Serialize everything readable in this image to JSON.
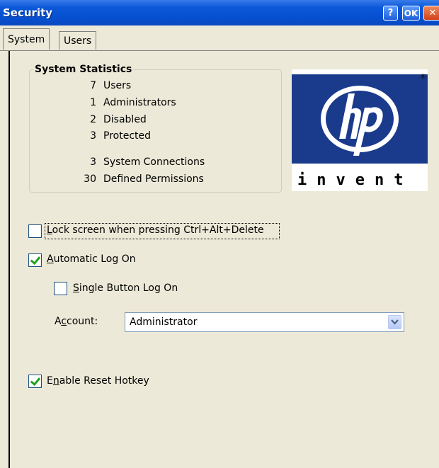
{
  "window": {
    "title": "Security",
    "help_label": "?",
    "ok_label": "OK",
    "close_label": "✕"
  },
  "tabs": [
    {
      "label": "System",
      "active": true
    },
    {
      "label": "Users",
      "active": false
    }
  ],
  "stats": {
    "heading": "System Statistics",
    "rows": [
      {
        "value": "7",
        "label": "Users"
      },
      {
        "value": "1",
        "label": "Administrators"
      },
      {
        "value": "2",
        "label": "Disabled"
      },
      {
        "value": "3",
        "label": "Protected"
      },
      {
        "value": "3",
        "label": "System Connections"
      },
      {
        "value": "30",
        "label": "Defined Permissions"
      }
    ]
  },
  "logo": {
    "mark": "hp",
    "tagline": "invent",
    "registered": "®"
  },
  "options": {
    "lock_screen": {
      "pre": "",
      "key": "L",
      "post": "ock screen when pressing Ctrl+Alt+Delete",
      "checked": false
    },
    "auto_logon": {
      "pre": "",
      "key": "A",
      "post": "utomatic Log On",
      "checked": true
    },
    "single_button": {
      "pre": "",
      "key": "S",
      "post": "ingle Button Log On",
      "checked": false
    },
    "reset_hotkey": {
      "pre": "E",
      "key": "n",
      "post": "able Reset Hotkey",
      "checked": true
    }
  },
  "account": {
    "label_pre": "A",
    "label_key": "c",
    "label_post": "count:",
    "value": "Administrator"
  },
  "colors": {
    "titlebar": "#0650d0",
    "logo_blue": "#1a3a8c",
    "check": "#21a121"
  }
}
